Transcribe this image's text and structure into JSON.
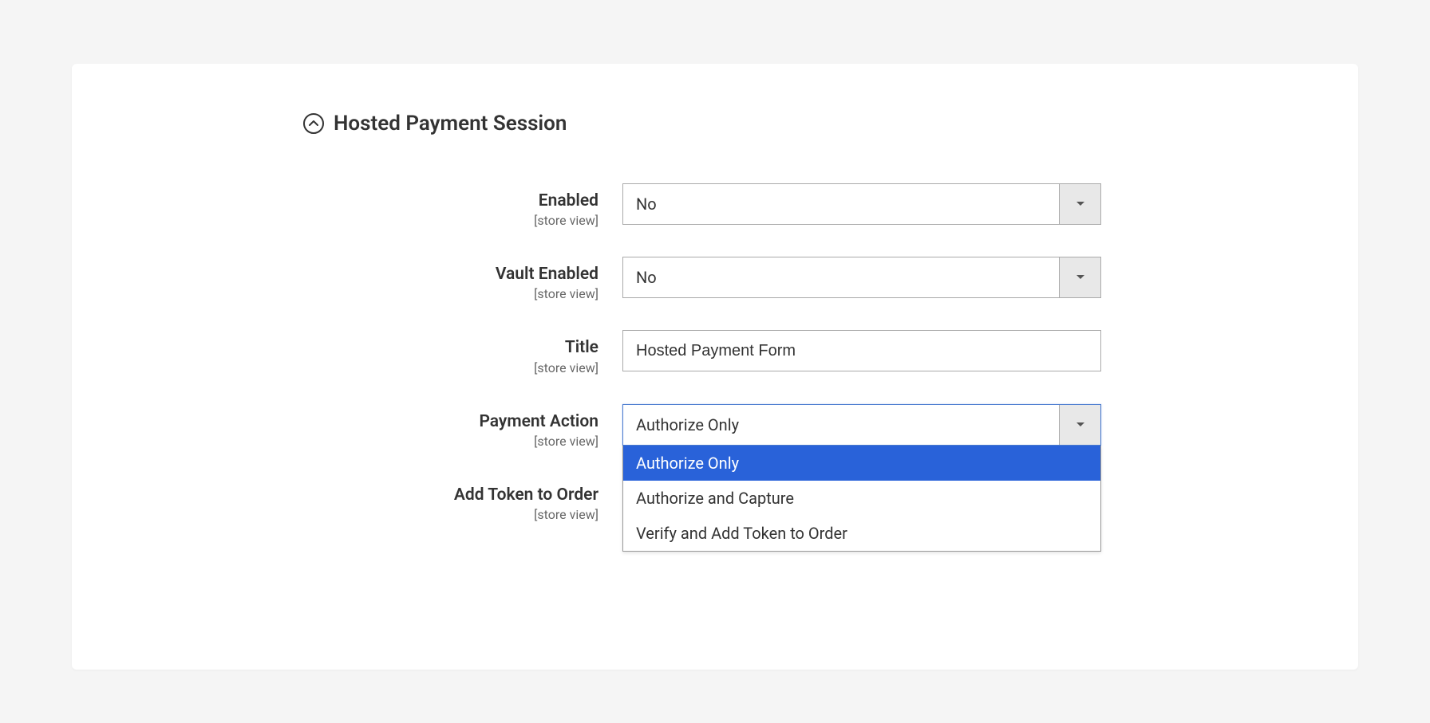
{
  "section": {
    "title": "Hosted Payment Session",
    "scope_label": "[store view]"
  },
  "fields": {
    "enabled": {
      "label": "Enabled",
      "value": "No"
    },
    "vault_enabled": {
      "label": "Vault Enabled",
      "value": "No"
    },
    "title": {
      "label": "Title",
      "value": "Hosted Payment Form"
    },
    "payment_action": {
      "label": "Payment Action",
      "value": "Authorize Only",
      "options": [
        "Authorize Only",
        "Authorize and Capture",
        "Verify and Add Token to Order"
      ]
    },
    "add_token": {
      "label": "Add Token to Order"
    }
  }
}
